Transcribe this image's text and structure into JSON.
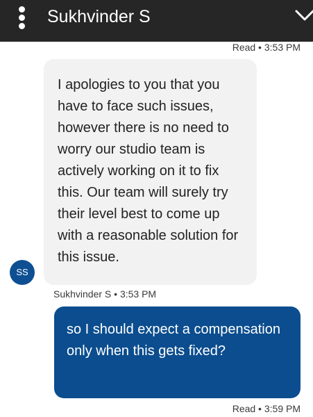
{
  "header": {
    "title": "Sukhvinder S",
    "menu_icon": "kebab-menu-icon",
    "collapse_icon": "chevron-down-icon",
    "background": "#262626"
  },
  "messages": [
    {
      "direction": "outgoing",
      "status": "Read • 3:53 PM"
    },
    {
      "direction": "incoming",
      "text": "I apologies to you that you have to face such issues, however there is no need to worry our studio team is actively working on it to fix this. Our team will surely try their level best to come up with a reasonable solution for this issue.",
      "sender_initials": "SS",
      "sender_meta": "Sukhvinder S • 3:53 PM",
      "bubble_color": "#f2f2f2"
    },
    {
      "direction": "outgoing",
      "text": "so I should expect a compensation only when this gets fixed?",
      "status": "Read • 3:59 PM",
      "bubble_color": "#0b4d8e"
    }
  ]
}
